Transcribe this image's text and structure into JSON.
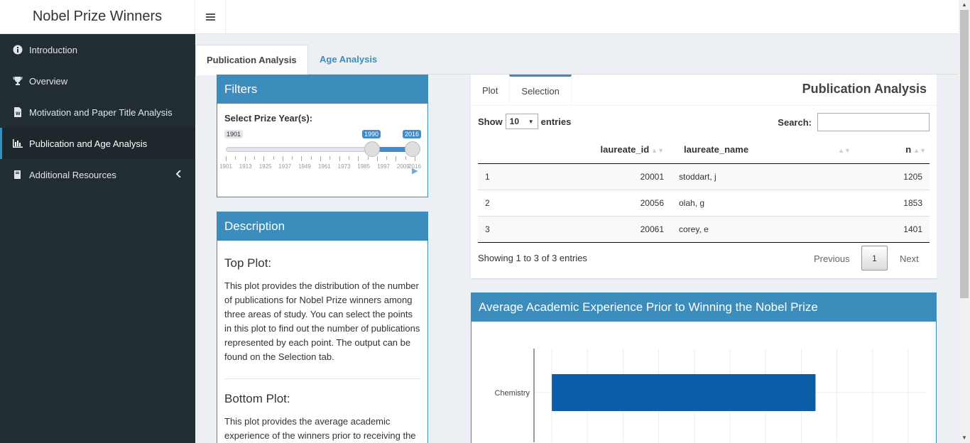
{
  "app": {
    "title": "Nobel Prize Winners"
  },
  "header": {
    "toggle_icon": "hamburger-icon"
  },
  "sidebar": {
    "items": [
      {
        "label": "Introduction",
        "icon": "info-circle-icon"
      },
      {
        "label": "Overview",
        "icon": "trophy-icon"
      },
      {
        "label": "Motivation and Paper Title Analysis",
        "icon": "word-file-icon"
      },
      {
        "label": "Publication and Age Analysis",
        "icon": "bar-chart-icon",
        "active": true
      },
      {
        "label": "Additional Resources",
        "icon": "book-icon",
        "arrow": "chevron-left-icon"
      }
    ]
  },
  "tabs": [
    {
      "label": "Publication Analysis",
      "active": true
    },
    {
      "label": "Age Analysis",
      "active": false
    }
  ],
  "filters": {
    "title": "Filters",
    "label": "Select Prize Year(s):",
    "min": "1901",
    "max": "2016",
    "from": "1990",
    "to": "2016",
    "tick_labels": [
      "1901",
      "1913",
      "1925",
      "1937",
      "1949",
      "1961",
      "1973",
      "1985",
      "1997",
      "2009",
      "2016"
    ]
  },
  "description": {
    "title": "Description",
    "sections": [
      {
        "heading": "Top Plot:",
        "text": "This plot provides the distribution of the number of publications for Nobel Prize winners among three areas of study. You can select the points in this plot to find out the number of publications represented by each point. The output can be found on the Selection tab."
      },
      {
        "heading": "Bottom Plot:",
        "text": "This plot provides the average academic experience of the winners prior to receiving the"
      }
    ]
  },
  "analysis": {
    "tabs": [
      {
        "label": "Plot",
        "active": false
      },
      {
        "label": "Selection",
        "active": true
      }
    ],
    "title": "Publication Analysis",
    "show_label": "Show",
    "entries_value": "10",
    "entries_label": "entries",
    "search_label": "Search:",
    "search_value": "",
    "columns": [
      "",
      "laureate_id",
      "laureate_name",
      "n"
    ],
    "rows": [
      [
        "1",
        "20001",
        "stoddart, j",
        "1205"
      ],
      [
        "2",
        "20056",
        "olah, g",
        "1853"
      ],
      [
        "3",
        "20061",
        "corey, e",
        "1401"
      ]
    ],
    "info": "Showing 1 to 3 of 3 entries",
    "pager": {
      "previous": "Previous",
      "current": "1",
      "next": "Next"
    }
  },
  "experience": {
    "title": "Average Academic Experience Prior to Winning the Nobel Prize"
  },
  "chart_data": {
    "type": "bar",
    "orientation": "horizontal",
    "categories": [
      "Chemistry"
    ],
    "values": [
      39.5
    ],
    "xlim": [
      0,
      55
    ],
    "grid": true,
    "bar_color": "#0a5ea8"
  }
}
